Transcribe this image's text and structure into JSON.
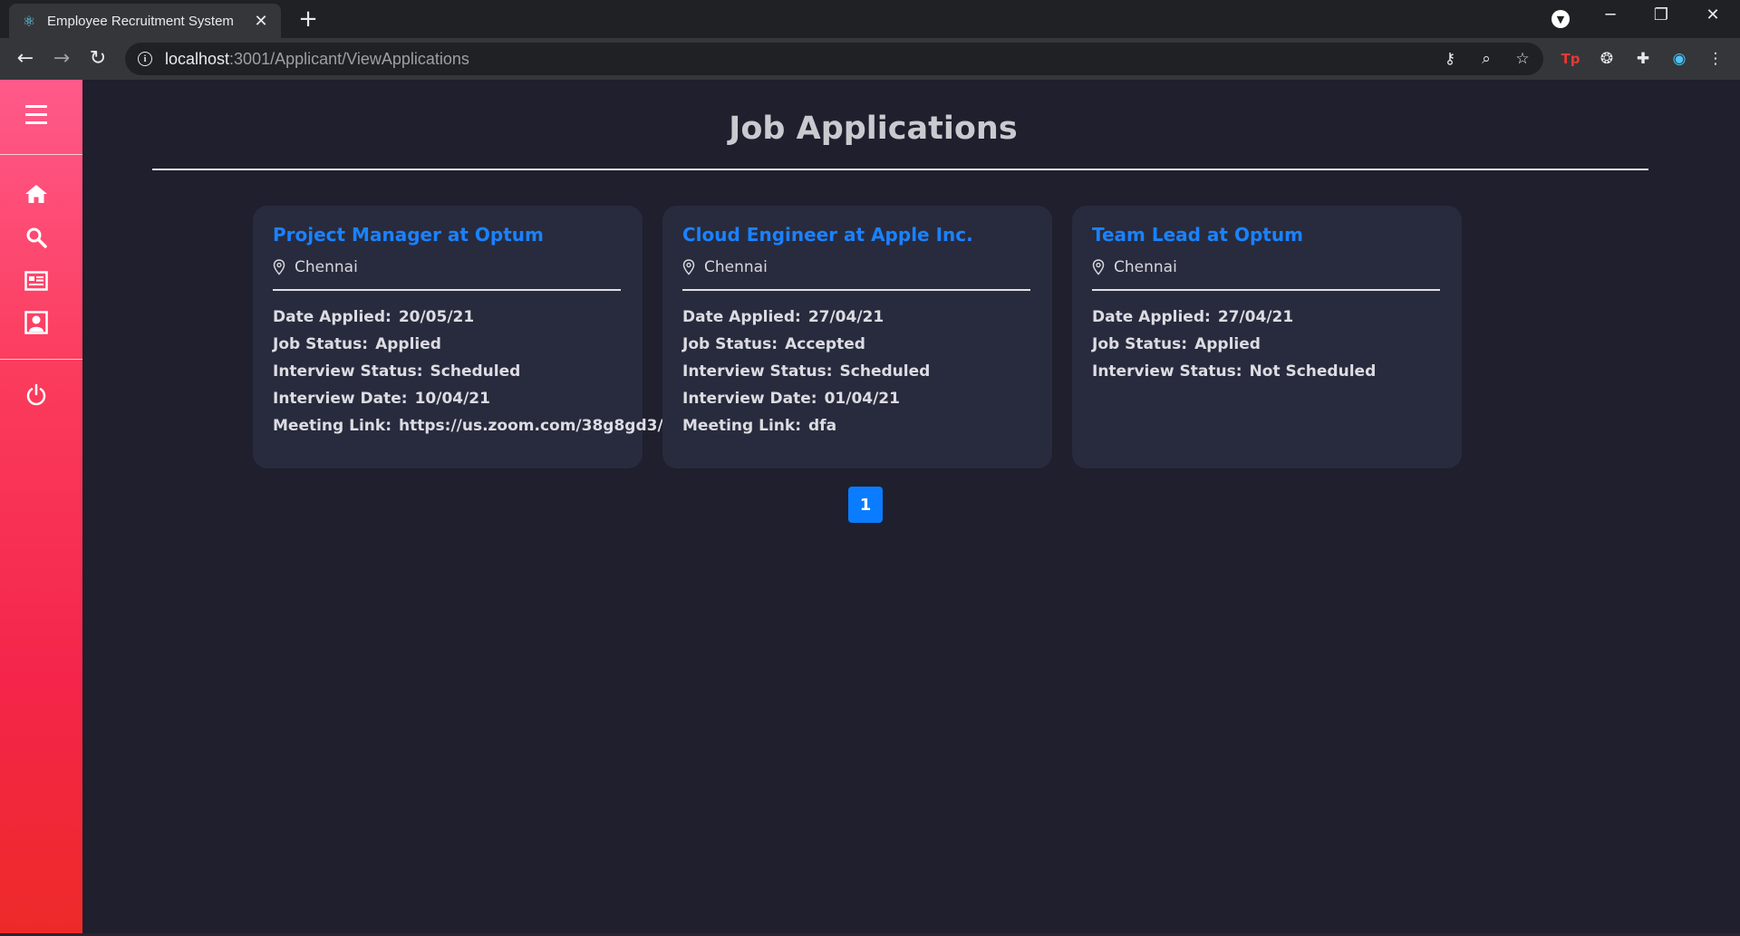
{
  "browser": {
    "tab_title": "Employee Recruitment System",
    "url_host": "localhost",
    "url_path": ":3001/Applicant/ViewApplications"
  },
  "page": {
    "title": "Job Applications"
  },
  "labels": {
    "date_applied": "Date Applied:",
    "job_status": "Job Status:",
    "interview_status": "Interview Status:",
    "interview_date": "Interview Date:",
    "meeting_link": "Meeting Link:"
  },
  "applications": [
    {
      "title": "Project Manager at Optum",
      "location": "Chennai",
      "date_applied": "20/05/21",
      "job_status": "Applied",
      "interview_status": "Scheduled",
      "interview_date": "10/04/21",
      "meeting_link": "https://us.zoom.com/38g8gd3/"
    },
    {
      "title": "Cloud Engineer at Apple Inc.",
      "location": "Chennai",
      "date_applied": "27/04/21",
      "job_status": "Accepted",
      "interview_status": "Scheduled",
      "interview_date": "01/04/21",
      "meeting_link": "dfa"
    },
    {
      "title": "Team Lead at Optum",
      "location": "Chennai",
      "date_applied": "27/04/21",
      "job_status": "Applied",
      "interview_status": "Not Scheduled"
    }
  ],
  "pagination": {
    "current_page": "1"
  },
  "icons": {
    "sidebar": [
      "menu-icon",
      "home-icon",
      "search-icon",
      "applications-icon",
      "profile-icon",
      "power-icon"
    ],
    "location": "location-pin-icon"
  },
  "colors": {
    "background": "#1f1f2d",
    "card": "#282b3d",
    "accent": "#1a82ff",
    "sidebar_top": "#ff5a8a",
    "sidebar_bottom": "#ee2a28"
  }
}
